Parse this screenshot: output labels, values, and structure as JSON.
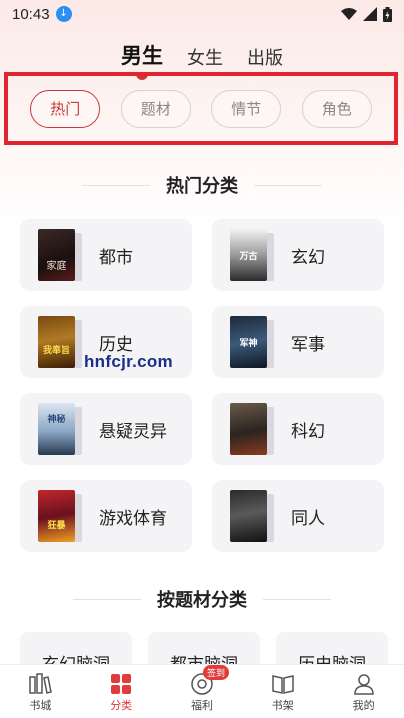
{
  "status": {
    "time": "10:43"
  },
  "gender_tabs": [
    {
      "label": "男生",
      "active": true
    },
    {
      "label": "女生",
      "active": false
    },
    {
      "label": "出版",
      "active": false
    }
  ],
  "filters": [
    {
      "label": "热门",
      "active": true
    },
    {
      "label": "题材",
      "active": false
    },
    {
      "label": "情节",
      "active": false
    },
    {
      "label": "角色",
      "active": false
    }
  ],
  "hot_section": {
    "title": "热门分类"
  },
  "categories": [
    {
      "label": "都市",
      "cover_text": "家庭"
    },
    {
      "label": "玄幻",
      "cover_text": "万古"
    },
    {
      "label": "历史",
      "cover_text": "我奉旨"
    },
    {
      "label": "军事",
      "cover_text": "军神"
    },
    {
      "label": "悬疑灵异",
      "cover_text": "神秘"
    },
    {
      "label": "科幻",
      "cover_text": ""
    },
    {
      "label": "游戏体育",
      "cover_text": "狂暴"
    },
    {
      "label": "同人",
      "cover_text": ""
    }
  ],
  "watermark": "hnfcjr.com",
  "theme_section": {
    "title": "按题材分类"
  },
  "themes": [
    "玄幻脑洞",
    "都市脑洞",
    "历史脑洞"
  ],
  "bottom_nav": [
    {
      "label": "书城",
      "icon": "bookstore-icon",
      "active": false
    },
    {
      "label": "分类",
      "icon": "category-grid-icon",
      "active": true
    },
    {
      "label": "福利",
      "icon": "welfare-icon",
      "active": false,
      "badge": "签到"
    },
    {
      "label": "书架",
      "icon": "bookshelf-icon",
      "active": false
    },
    {
      "label": "我的",
      "icon": "profile-icon",
      "active": false
    }
  ],
  "colors": {
    "accent": "#e0252e",
    "active_red": "#c9383b"
  }
}
